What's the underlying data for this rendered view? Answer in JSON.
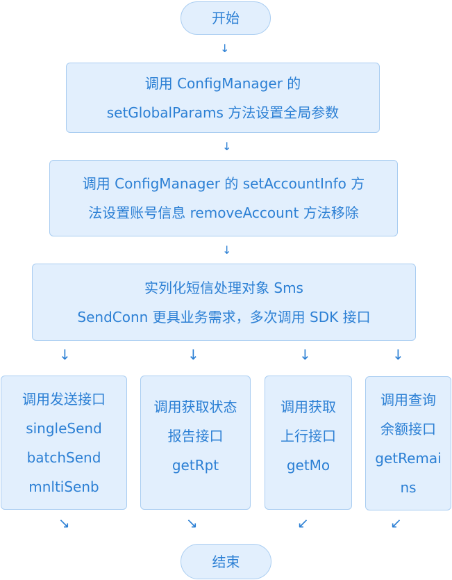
{
  "start": "开始",
  "end": "结束",
  "steps": [
    {
      "lines": [
        "调用 ConfigManager 的",
        "setGlobalParams 方法设置全局参数"
      ]
    },
    {
      "lines": [
        "调用 ConfigManager 的 setAccountInfo 方",
        "法设置账号信息 removeAccount 方法移除"
      ]
    },
    {
      "lines": [
        "实列化短信处理对象 Sms",
        "SendConn 更具业务需求，多次调用 SDK 接口"
      ]
    }
  ],
  "branches": [
    {
      "lines": [
        "调用发送接口",
        "singleSend",
        "batchSend",
        "mnltiSenb"
      ]
    },
    {
      "lines": [
        "调用获取状态",
        "报告接口",
        "getRpt"
      ]
    },
    {
      "lines": [
        "调用获取",
        "上行接口",
        "getMo"
      ]
    },
    {
      "lines": [
        "调用查询",
        "余额接口",
        "getRemai",
        "ns"
      ]
    }
  ],
  "colors": {
    "fill": "#e2effd",
    "border": "#a9cdf1",
    "text": "#2b7fd4"
  }
}
